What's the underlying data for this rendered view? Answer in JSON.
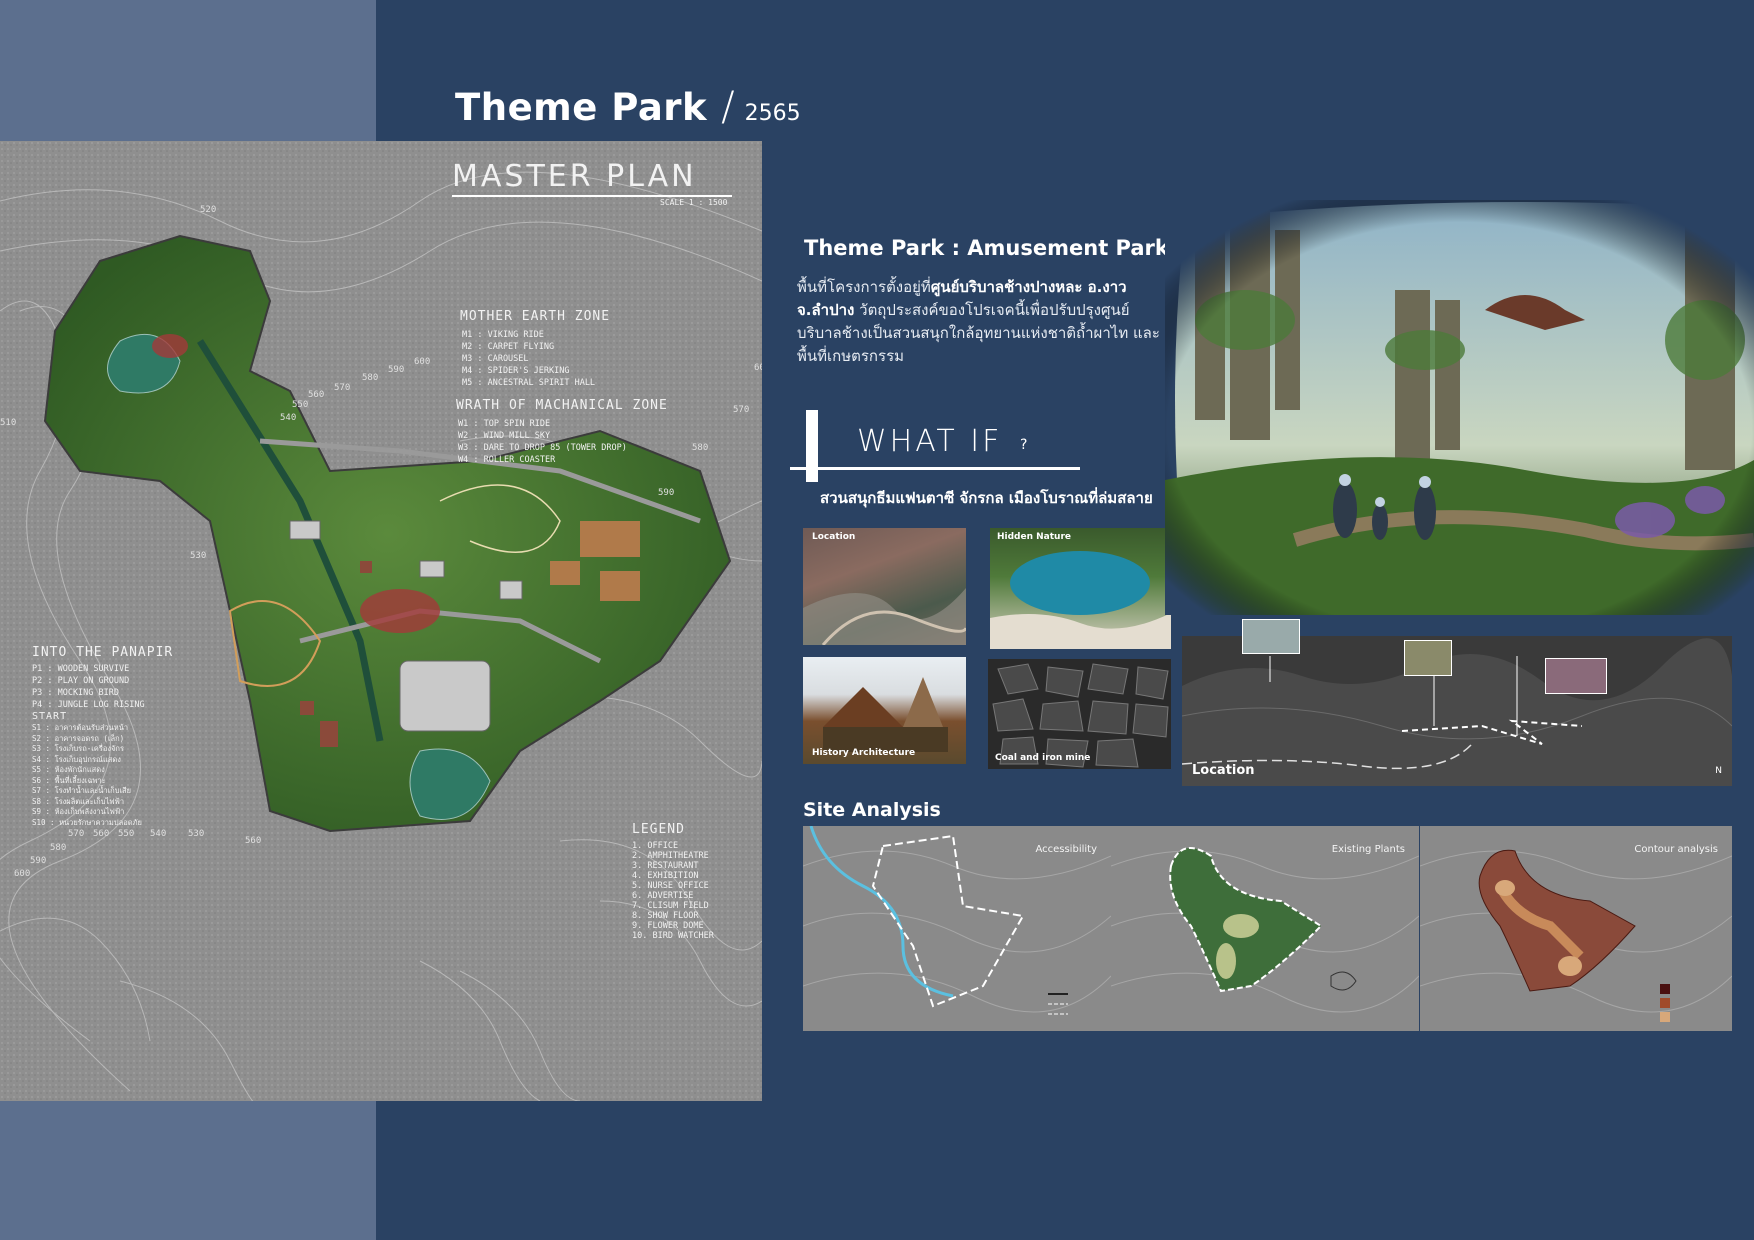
{
  "header": {
    "title": "Theme Park",
    "slash": "/",
    "year": "2565"
  },
  "master_plan": {
    "title": "MASTER PLAN",
    "scale": "SCALE 1 : 1500",
    "mother_zone": {
      "heading": "MOTHER EARTH ZONE",
      "items": "M1 : VIKING RIDE\nM2 : CARPET FLYING\nM3 : CAROUSEL\nM4 : SPIDER'S JERKING\nM5 : ANCESTRAL SPIRIT HALL"
    },
    "wrath_zone": {
      "heading": "WRATH OF MACHANICAL ZONE",
      "items": "W1 : TOP SPIN RIDE\nW2 : WIND MILL SKY\nW3 : DARE TO DROP 85 (TOWER DROP)\nW4 : ROLLER COASTER"
    },
    "pandora_zone": {
      "heading": "INTO THE PANAPIR",
      "items": "P1 : WOODEN SURVIVE\nP2 : PLAY ON GROUND\nP3 : MOCKING BIRD\nP4 : JUNGLE LOG RISING"
    },
    "start_zone": {
      "heading": "START",
      "items": "S1 : อาคารต้อนรับส่วนหน้า\nS2 : อาคารจอดรถ (เล็ก)\nS3 : โรงเก็บรถ-เครื่องจักร\nS4 : โรงเก็บอุปกรณ์แสดง\nS5 : ห้องพักนักแสดง\nS6 : พื้นที่เลี้ยงเฉพาะ\nS7 : โรงทำน้ำและน้ำเก็บเสีย\nS8 : โรงผลิตและเก็บไฟฟ้า\nS9 : ห้องเก็บพลังงานไฟฟ้า\nS10 : หน่วยรักษาความปลอดภัย"
    },
    "legend": {
      "heading": "LEGEND",
      "items": "1. OFFICE\n2. AMPHITHEATRE\n3. RESTAURANT\n4. EXHIBITION\n5. NURSE OFFICE\n6. ADVERTISE\n7. CLISUM FIELD\n8. SHOW FLOOR\n9. FLOWER DOME\n10. BIRD WATCHER"
    },
    "contours": [
      "520",
      "510",
      "530",
      "540",
      "550",
      "560",
      "570",
      "580",
      "590",
      "600",
      "600",
      "590",
      "580",
      "570",
      "560",
      "550",
      "540",
      "530",
      "560",
      "570",
      "580",
      "590",
      "600"
    ]
  },
  "intro": {
    "heading": "Theme Park : Amusement Park",
    "desc_1": "พื้นที่โครงการตั้งอยู่ที่",
    "desc_bold": "ศูนย์บริบาลช้างปางหละ อ.งาว จ.ลำปาง",
    "desc_2": " วัตถุประสงค์ของโปรเจคนี้เพื่อปรับปรุงศูนย์บริบาลช้างเป็นสวนสนุกใกล้อุทยานแห่งชาติถ้ำผาไท และพื้นที่เกษตรกรรม"
  },
  "whatif": {
    "label": "WHAT IF",
    "q": "?",
    "subtitle": "สวนสนุกธีมแฟนตาซี จักรกล เมืองโบราณที่ล่มสลาย"
  },
  "photos": {
    "location": "Location",
    "hidden": "Hidden Nature",
    "history": "History Architecture",
    "coal": "Coal and iron mine"
  },
  "elevation": {
    "caption": "Location",
    "north": "N"
  },
  "site_analysis": {
    "heading": "Site Analysis",
    "panels": [
      "Accessibility",
      "Existing Plants",
      "Contour analysis"
    ]
  },
  "colors": {
    "background": "#2a4263",
    "side_panel": "#5c6f8e"
  }
}
